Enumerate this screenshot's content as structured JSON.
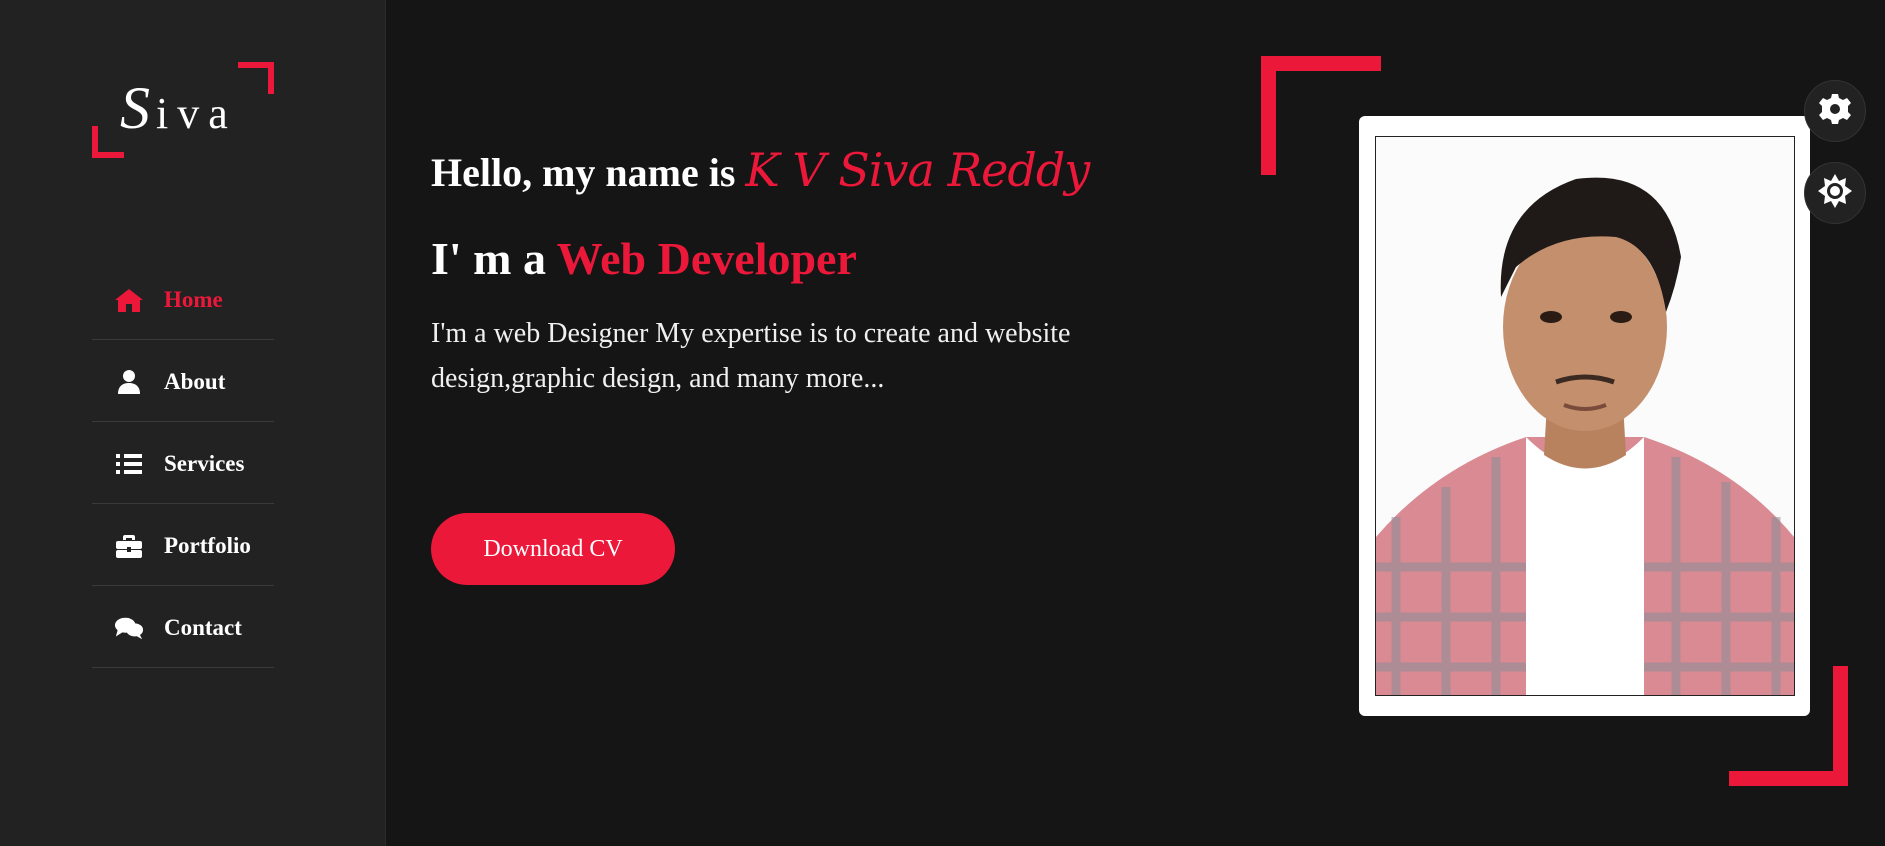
{
  "logo": {
    "first_letter": "S",
    "rest": "iva"
  },
  "nav": {
    "items": [
      {
        "label": "Home",
        "icon": "home-icon",
        "active": true
      },
      {
        "label": "About",
        "icon": "user-icon",
        "active": false
      },
      {
        "label": "Services",
        "icon": "list-icon",
        "active": false
      },
      {
        "label": "Portfolio",
        "icon": "briefcase-icon",
        "active": false
      },
      {
        "label": "Contact",
        "icon": "comments-icon",
        "active": false
      }
    ]
  },
  "hero": {
    "hello_prefix": "Hello, my name is ",
    "name": "K V Siva Reddy",
    "role_prefix": "I' m a ",
    "role": "Web Developer",
    "description": "I'm a web Designer My expertise is to create and website design,graphic design, and many more...",
    "button_label": "Download CV"
  },
  "tools": [
    {
      "icon": "gear-icon"
    },
    {
      "icon": "sun-icon"
    }
  ],
  "colors": {
    "accent": "#ec1839",
    "background": "#151516",
    "sidebar": "#222223"
  }
}
